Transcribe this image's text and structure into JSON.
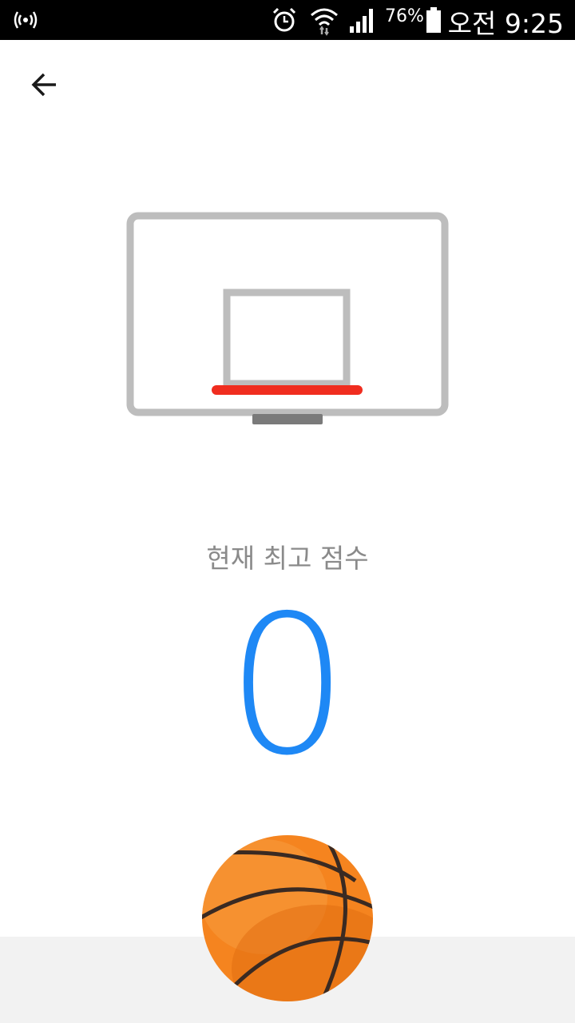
{
  "status_bar": {
    "battery_percent": "76%",
    "time": "오전 9:25",
    "icons": [
      "signal-broadcast-icon",
      "alarm-icon",
      "wifi-icon",
      "cellular-signal-icon",
      "battery-icon"
    ]
  },
  "nav": {
    "back_icon": "arrow-back-icon"
  },
  "game": {
    "title": "현재 최고 점수",
    "score": "0",
    "colors": {
      "backboard": "#bdbdbd",
      "rim": "#f02d1f",
      "score": "#1e88f5",
      "ball": "#f5841f",
      "floor": "#f2f2f2"
    }
  }
}
